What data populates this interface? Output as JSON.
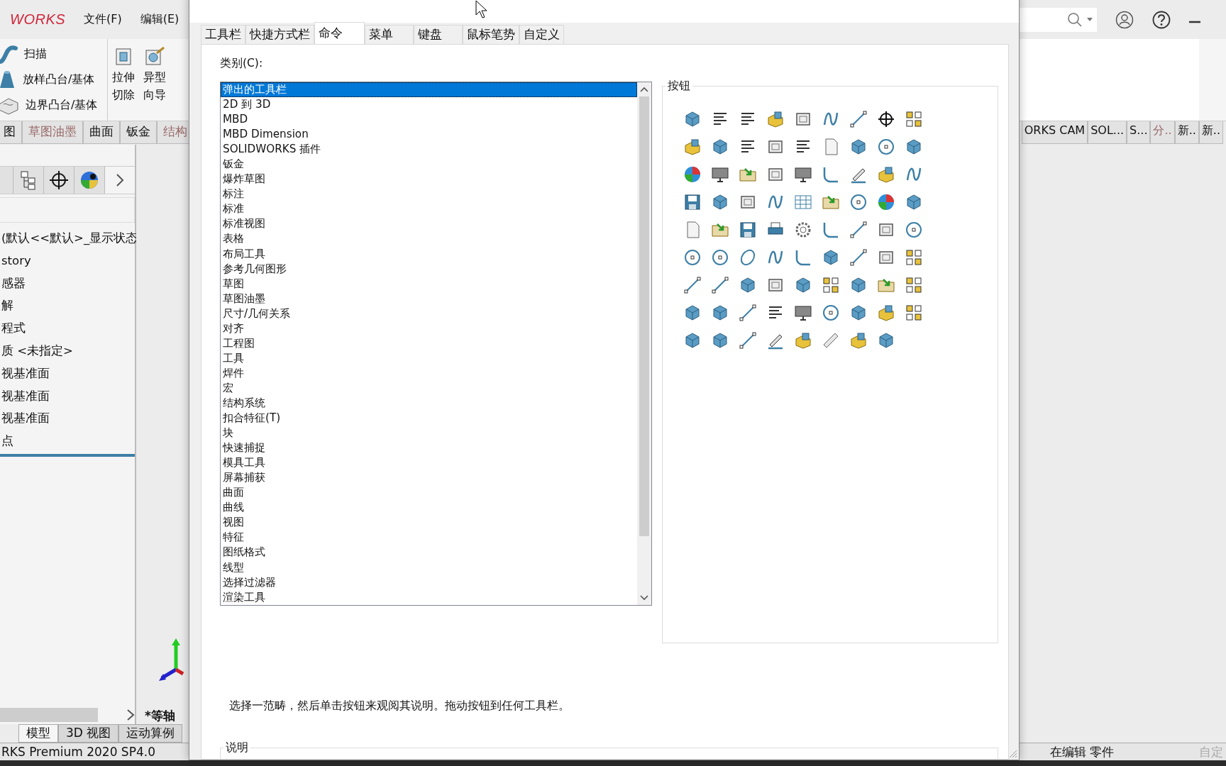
{
  "app": {
    "logo": "WORKS",
    "menu": [
      "文件(F)",
      "编辑(E)"
    ],
    "ribbon": [
      {
        "label": "扫描",
        "kind": "sweep"
      },
      {
        "label": "放样凸台/基体",
        "kind": "loft"
      },
      {
        "label": "边界凸台/基体",
        "kind": "boundary"
      }
    ],
    "big_buttons": [
      {
        "lines": [
          "拉伸",
          "切除"
        ],
        "kind": "cut"
      },
      {
        "lines": [
          "异型",
          "向导"
        ],
        "kind": "hole"
      }
    ],
    "tabs_left": [
      {
        "label": "图",
        "dimmed": false
      },
      {
        "label": "草图油墨",
        "dimmed": true
      },
      {
        "label": "曲面",
        "dimmed": false
      },
      {
        "label": "钣金",
        "dimmed": false
      },
      {
        "label": "结构",
        "dimmed": true
      }
    ],
    "tabs_right": [
      {
        "label": "ORKS CAM",
        "dimmed": false
      },
      {
        "label": "SOL...",
        "dimmed": false
      },
      {
        "label": "S...",
        "dimmed": false
      },
      {
        "label": "分..",
        "dimmed": true
      },
      {
        "label": "新..",
        "dimmed": false
      },
      {
        "label": "新..",
        "dimmed": false
      }
    ],
    "tree": [
      "(默认<<默认>_显示状态",
      "story",
      "感器",
      "解",
      "程式",
      "质 <未指定>",
      "视基准面",
      "视基准面",
      "视基准面",
      "点"
    ],
    "view_label": "*等轴",
    "bottom_tabs": [
      {
        "label": "模型",
        "selected": true
      },
      {
        "label": "3D 视图",
        "selected": false
      },
      {
        "label": "运动算例",
        "selected": false
      }
    ],
    "status_bar": {
      "version": "RKS Premium 2020 SP4.0",
      "mode": "在编辑 零件",
      "custom": "自定"
    }
  },
  "dialog": {
    "tabs": [
      {
        "label": "工具栏",
        "selected": false
      },
      {
        "label": "快捷方式栏",
        "selected": false
      },
      {
        "label": "命令",
        "selected": true
      },
      {
        "label": "菜单",
        "selected": false
      },
      {
        "label": "键盘",
        "selected": false
      },
      {
        "label": "鼠标笔势",
        "selected": false
      },
      {
        "label": "自定义",
        "selected": false
      }
    ],
    "category_label": "类别(C):",
    "categories": [
      {
        "label": "弹出的工具栏",
        "selected": true
      },
      {
        "label": "2D 到 3D",
        "selected": false
      },
      {
        "label": "MBD",
        "selected": false
      },
      {
        "label": "MBD Dimension",
        "selected": false
      },
      {
        "label": "SOLIDWORKS 插件",
        "selected": false
      },
      {
        "label": "钣金",
        "selected": false
      },
      {
        "label": "爆炸草图",
        "selected": false
      },
      {
        "label": "标注",
        "selected": false
      },
      {
        "label": "标准",
        "selected": false
      },
      {
        "label": "标准视图",
        "selected": false
      },
      {
        "label": "表格",
        "selected": false
      },
      {
        "label": "布局工具",
        "selected": false
      },
      {
        "label": "参考几何图形",
        "selected": false
      },
      {
        "label": "草图",
        "selected": false
      },
      {
        "label": "草图油墨",
        "selected": false
      },
      {
        "label": "尺寸/几何关系",
        "selected": false
      },
      {
        "label": "对齐",
        "selected": false
      },
      {
        "label": "工程图",
        "selected": false
      },
      {
        "label": "工具",
        "selected": false
      },
      {
        "label": "焊件",
        "selected": false
      },
      {
        "label": "宏",
        "selected": false
      },
      {
        "label": "结构系统",
        "selected": false
      },
      {
        "label": "扣合特征(T)",
        "selected": false
      },
      {
        "label": "块",
        "selected": false
      },
      {
        "label": "快速捕捉",
        "selected": false
      },
      {
        "label": "模具工具",
        "selected": false
      },
      {
        "label": "屏幕捕获",
        "selected": false
      },
      {
        "label": "曲面",
        "selected": false
      },
      {
        "label": "曲线",
        "selected": false
      },
      {
        "label": "视图",
        "selected": false
      },
      {
        "label": "特征",
        "selected": false
      },
      {
        "label": "图纸格式",
        "selected": false
      },
      {
        "label": "线型",
        "selected": false
      },
      {
        "label": "选择过滤器",
        "selected": false
      },
      {
        "label": "渲染工具",
        "selected": false
      }
    ],
    "buttons_group": "按钮",
    "hint": "选择一范畴，然后单击按钮来观阅其说明。拖动按钮到任何工具栏。",
    "description_group": "说明"
  }
}
